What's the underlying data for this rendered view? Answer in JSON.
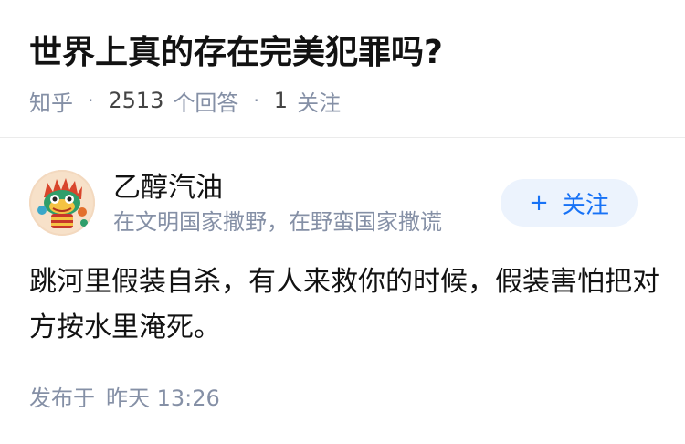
{
  "question": {
    "title": "世界上真的存在完美犯罪吗?",
    "source": "知乎",
    "answer_count": "2513",
    "answer_label": "个回答",
    "follow_count": "1",
    "follow_label": "关注"
  },
  "author": {
    "name": "乙醇汽油",
    "bio": "在文明国家撒野，在野蛮国家撒谎",
    "avatar_icon": "dragon-dance-avatar",
    "follow_button": {
      "plus": "+",
      "label": "关注"
    }
  },
  "answer": {
    "content": "跳河里假装自杀，有人来救你的时候，假装害怕把对方按水里淹死。",
    "publish_label": "发布于",
    "publish_time": "昨天 13:26"
  },
  "colors": {
    "accent": "#1772f6",
    "button_bg": "#ecf3fd",
    "muted": "#8590a6"
  }
}
